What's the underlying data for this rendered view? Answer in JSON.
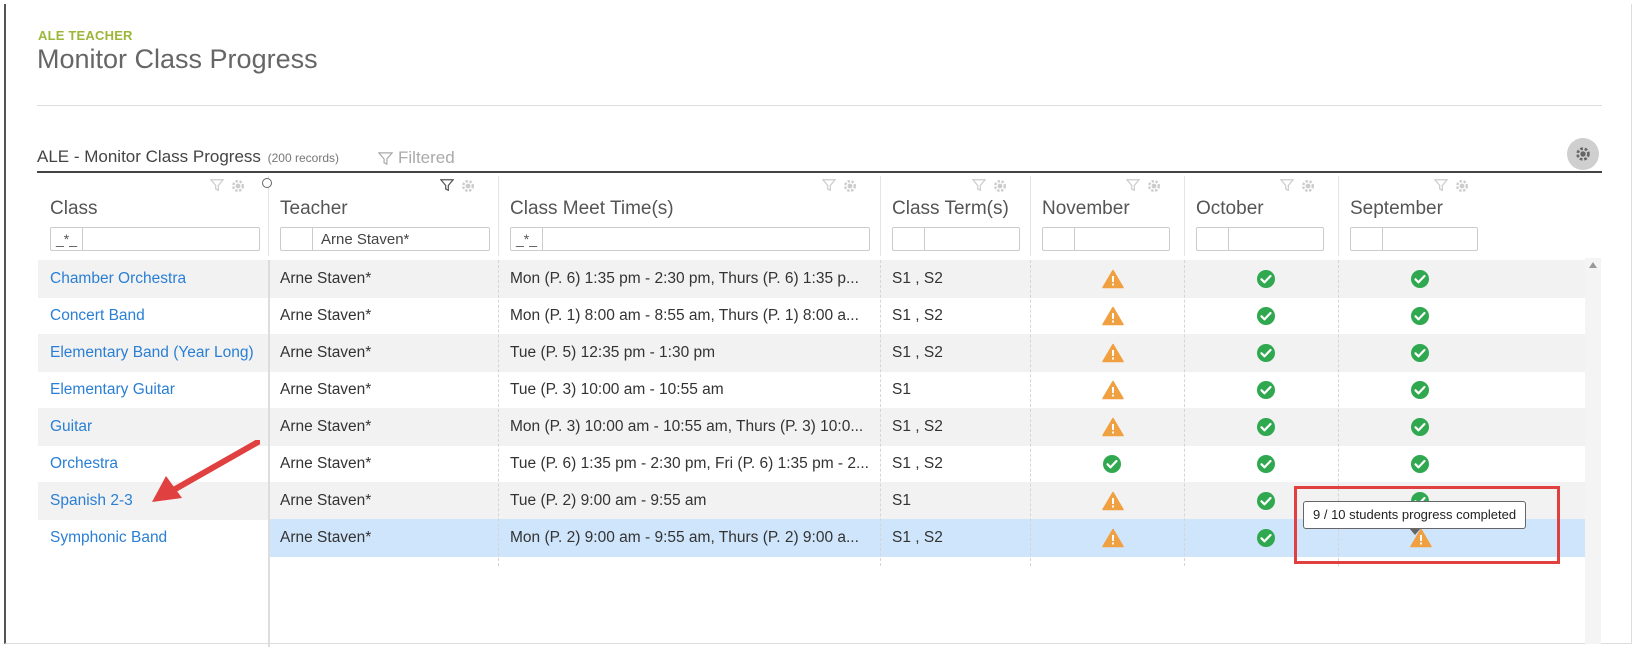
{
  "header": {
    "app_label": "ALE TEACHER",
    "page_title": "Monitor Class Progress"
  },
  "grid": {
    "title": "ALE - Monitor Class Progress",
    "record_count": "(200 records)",
    "filtered_label": "Filtered",
    "columns": [
      {
        "key": "class",
        "label": "Class",
        "filter_prefix": "_*_",
        "filter_value": ""
      },
      {
        "key": "teacher",
        "label": "Teacher",
        "filter_prefix": "",
        "filter_value": "Arne Staven*"
      },
      {
        "key": "meet",
        "label": "Class Meet Time(s)",
        "filter_prefix": "_*_",
        "filter_value": ""
      },
      {
        "key": "term",
        "label": "Class Term(s)",
        "filter_prefix": "",
        "filter_value": ""
      },
      {
        "key": "nov",
        "label": "November",
        "filter_prefix": "",
        "filter_value": ""
      },
      {
        "key": "oct",
        "label": "October",
        "filter_prefix": "",
        "filter_value": ""
      },
      {
        "key": "sep",
        "label": "September",
        "filter_prefix": "",
        "filter_value": ""
      }
    ],
    "rows": [
      {
        "class": "Chamber Orchestra",
        "teacher": "Arne Staven*",
        "meet": "Mon (P. 6) 1:35 pm - 2:30 pm, Thurs (P. 6) 1:35 p...",
        "term": "S1 , S2",
        "nov": "warning",
        "oct": "check",
        "sep": "check"
      },
      {
        "class": "Concert Band",
        "teacher": "Arne Staven*",
        "meet": "Mon (P. 1) 8:00 am - 8:55 am, Thurs (P. 1) 8:00 a...",
        "term": "S1 , S2",
        "nov": "warning",
        "oct": "check",
        "sep": "check"
      },
      {
        "class": "Elementary Band (Year Long)",
        "teacher": "Arne Staven*",
        "meet": "Tue (P. 5) 12:35 pm - 1:30 pm",
        "term": "S1 , S2",
        "nov": "warning",
        "oct": "check",
        "sep": "check"
      },
      {
        "class": "Elementary Guitar",
        "teacher": "Arne Staven*",
        "meet": "Tue (P. 3) 10:00 am - 10:55 am",
        "term": "S1",
        "nov": "warning",
        "oct": "check",
        "sep": "check"
      },
      {
        "class": "Guitar",
        "teacher": "Arne Staven*",
        "meet": "Mon (P. 3) 10:00 am - 10:55 am, Thurs (P. 3) 10:0...",
        "term": "S1 , S2",
        "nov": "warning",
        "oct": "check",
        "sep": "check"
      },
      {
        "class": "Orchestra",
        "teacher": "Arne Staven*",
        "meet": "Tue (P. 6) 1:35 pm - 2:30 pm, Fri (P. 6) 1:35 pm - 2...",
        "term": "S1 , S2",
        "nov": "check",
        "oct": "check",
        "sep": "check"
      },
      {
        "class": "Spanish 2-3",
        "teacher": "Arne Staven*",
        "meet": "Tue (P. 2) 9:00 am - 9:55 am",
        "term": "S1",
        "nov": "warning",
        "oct": "check",
        "sep": "check"
      },
      {
        "class": "Symphonic Band",
        "teacher": "Arne Staven*",
        "meet": "Mon (P. 2) 9:00 am - 9:55 am, Thurs (P. 2) 9:00 a...",
        "term": "S1 , S2",
        "nov": "warning",
        "oct": "check",
        "sep": "warning"
      }
    ],
    "selected_row_index": 7
  },
  "tooltip": {
    "text": "9 / 10 students progress completed"
  },
  "colors": {
    "accent": "#9bb73a",
    "link": "#2a7fd4",
    "check": "#2fa84f",
    "warning": "#f0a040",
    "selected_row": "#cfe5fb",
    "annotation": "#e04040"
  },
  "icons": {
    "filter": "filter-icon",
    "settings": "gear-icon",
    "check": "check-circle-icon",
    "warning": "warning-triangle-icon",
    "annotation_arrow": "red-arrow-icon"
  }
}
